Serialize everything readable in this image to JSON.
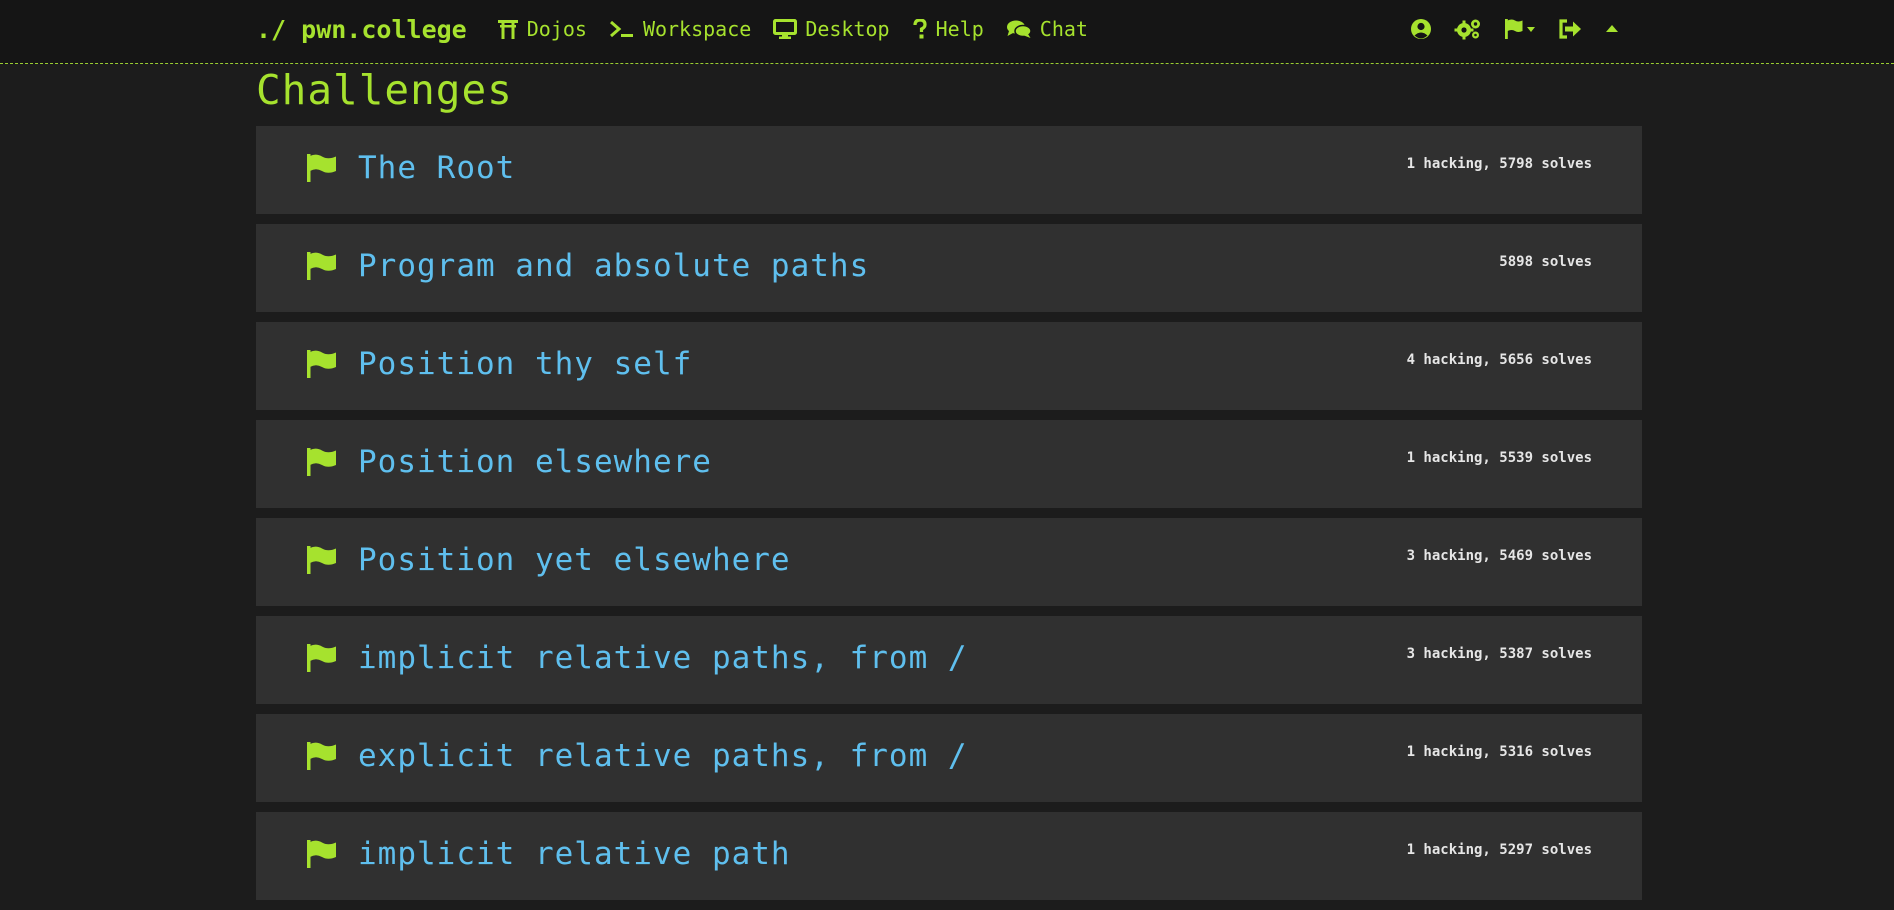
{
  "nav": {
    "brand": "./ pwn.college",
    "links": [
      {
        "label": "Dojos",
        "icon": "torii-gate-icon"
      },
      {
        "label": "Workspace",
        "icon": "terminal-icon"
      },
      {
        "label": "Desktop",
        "icon": "desktop-icon"
      },
      {
        "label": "Help",
        "icon": "question-icon"
      },
      {
        "label": "Chat",
        "icon": "chat-icon"
      }
    ],
    "right_icons": [
      "user-icon",
      "settings-icon",
      "flag-dropdown-icon",
      "logout-icon",
      "caret-up-icon"
    ],
    "accent_color": "#a6e22e"
  },
  "page": {
    "title": "Challenges"
  },
  "challenges": [
    {
      "name": "The Root",
      "stats": "1 hacking, 5798 solves"
    },
    {
      "name": "Program and absolute paths",
      "stats": "5898 solves"
    },
    {
      "name": "Position thy self",
      "stats": "4 hacking, 5656 solves"
    },
    {
      "name": "Position elsewhere",
      "stats": "1 hacking, 5539 solves"
    },
    {
      "name": "Position yet elsewhere",
      "stats": "3 hacking, 5469 solves"
    },
    {
      "name": "implicit relative paths, from /",
      "stats": "3 hacking, 5387 solves"
    },
    {
      "name": "explicit relative paths, from /",
      "stats": "1 hacking, 5316 solves"
    },
    {
      "name": "implicit relative path",
      "stats": "1 hacking, 5297 solves"
    }
  ],
  "colors": {
    "challenge_name": "#5fbfee",
    "flag": "#a6e22e",
    "row_background": "#303030"
  }
}
